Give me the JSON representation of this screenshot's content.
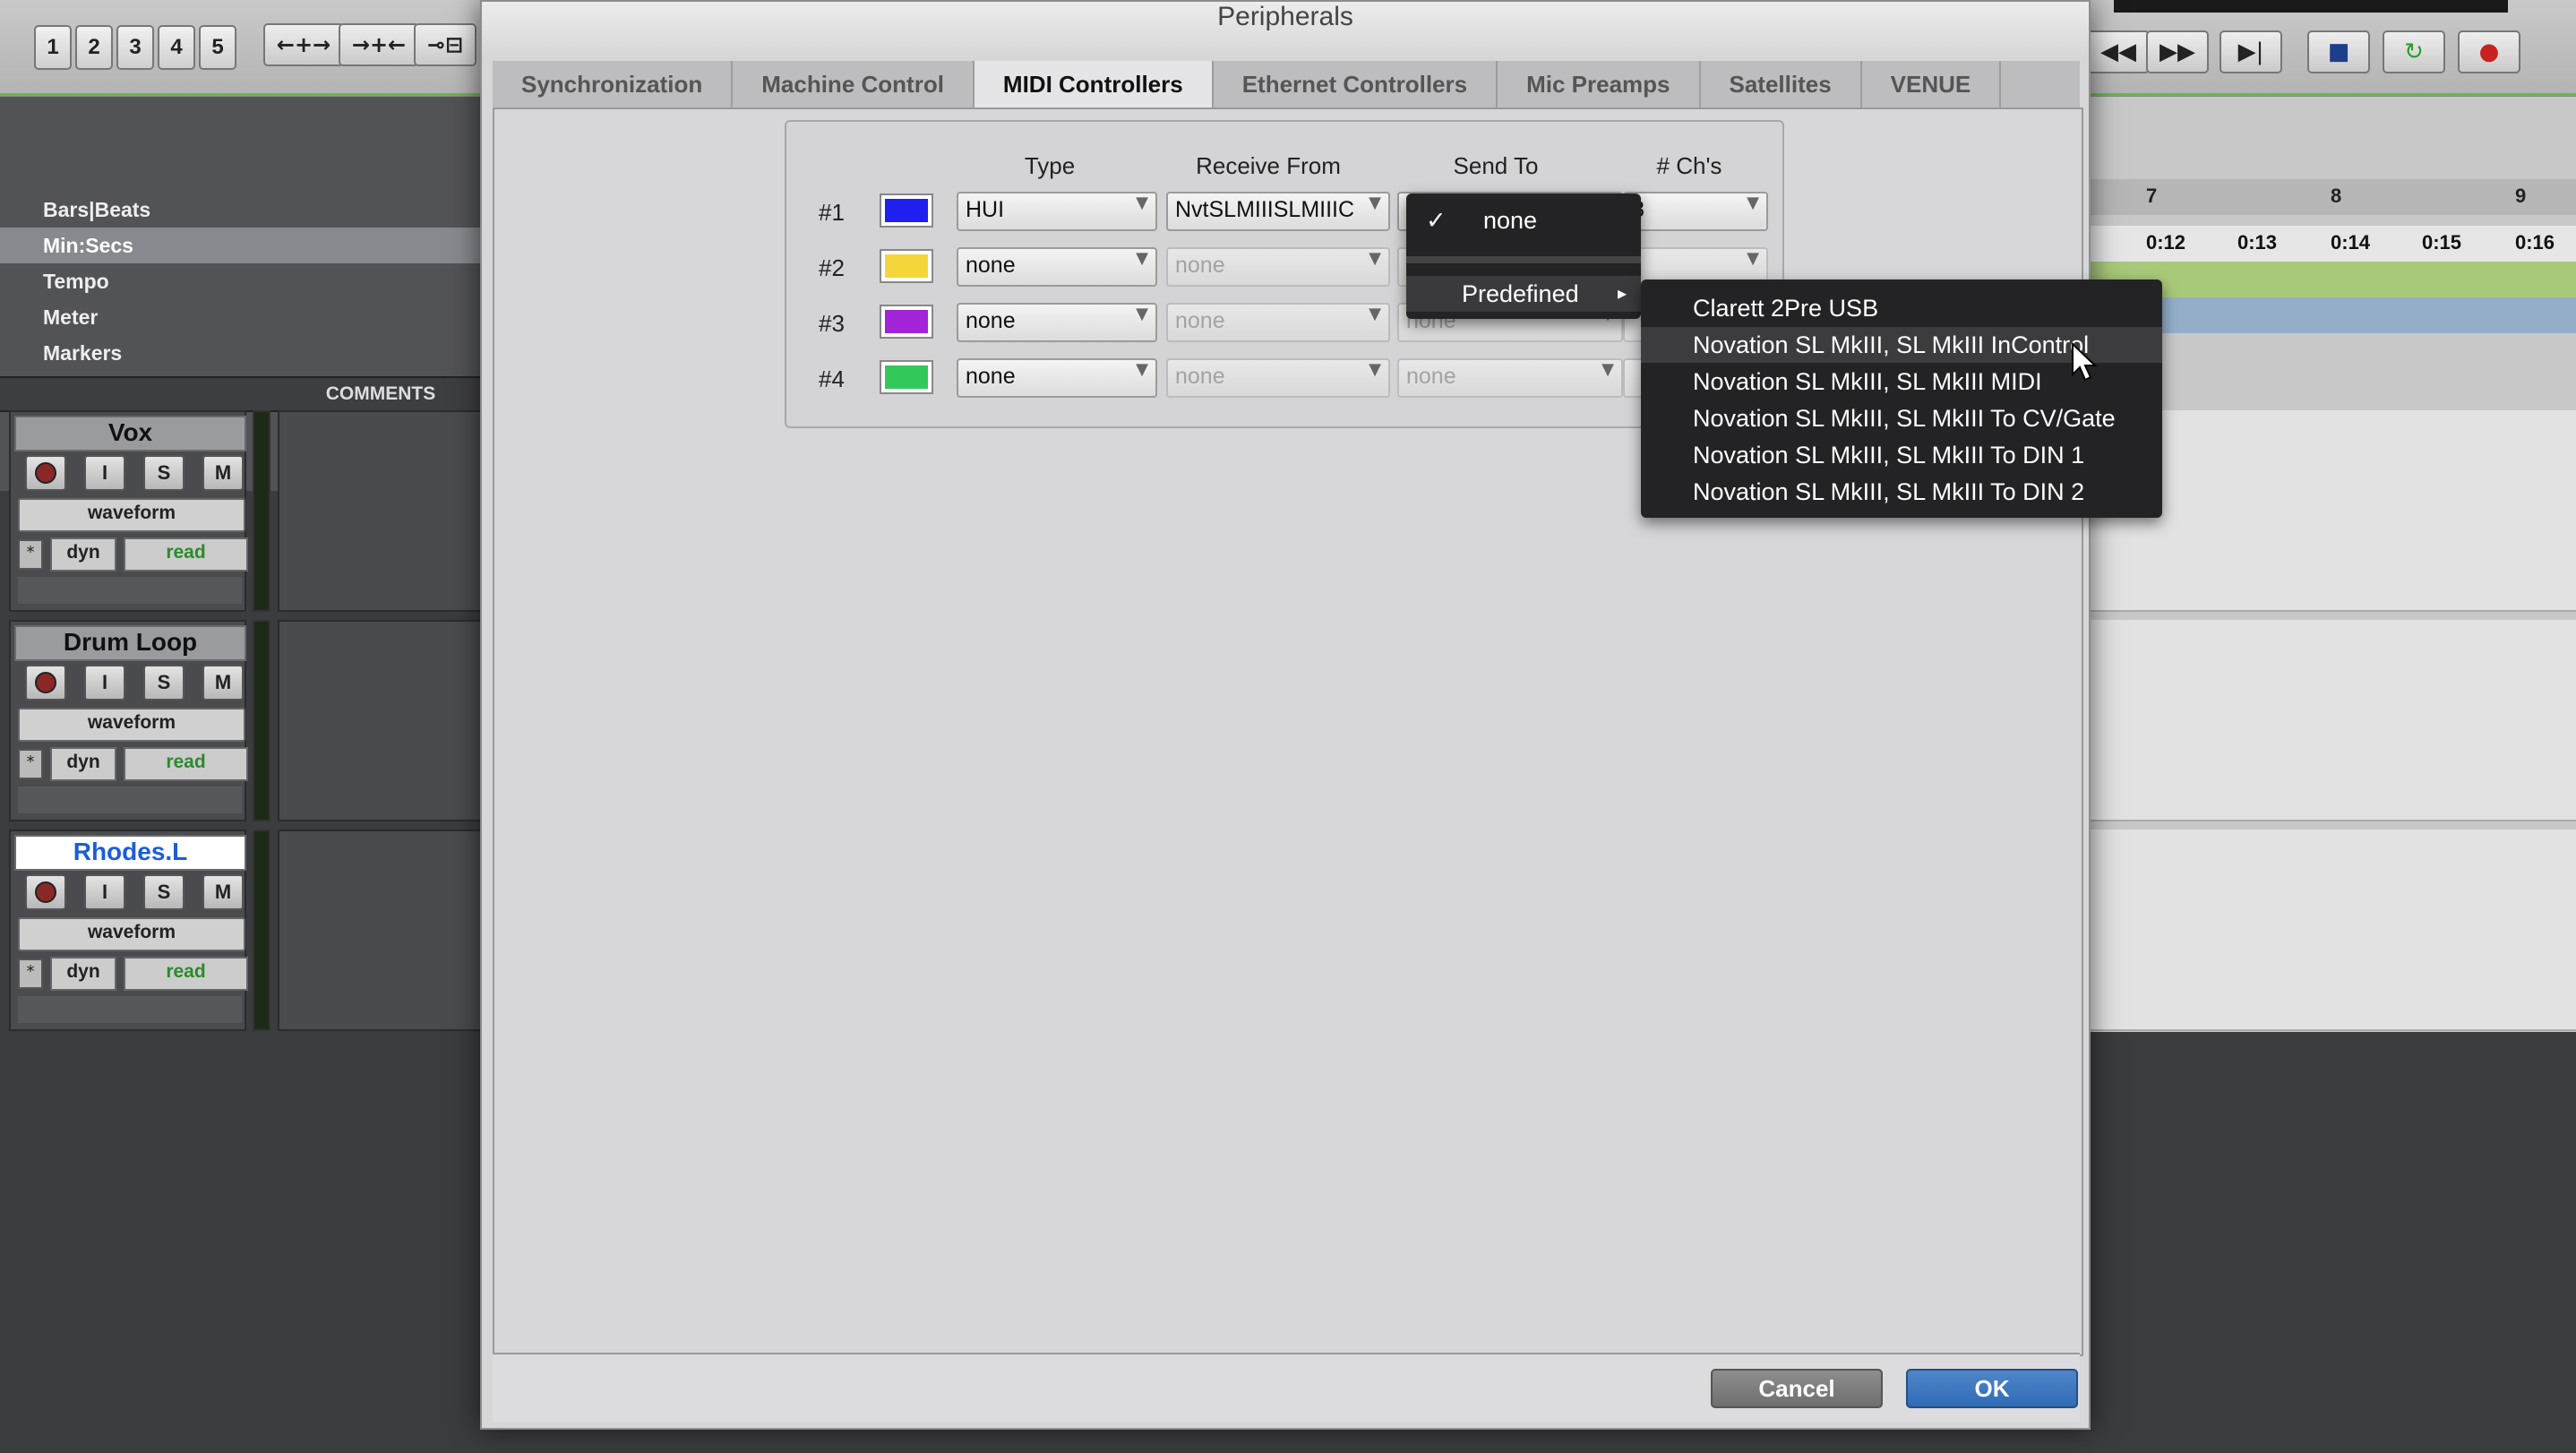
{
  "daw": {
    "toolbar": {
      "zoom_presets": [
        "1",
        "2",
        "3",
        "4",
        "5"
      ],
      "edit_tool_glyphs": [
        "←+→",
        "→+←",
        "⊸⊟"
      ],
      "transport_glyphs": [
        "◀◀",
        "▶▶",
        "▶|",
        "■",
        "↻",
        "●"
      ]
    },
    "rulers": {
      "items": [
        "Bars|Beats",
        "Min:Secs",
        "Tempo",
        "Meter",
        "Markers"
      ],
      "selected": "Min:Secs"
    },
    "comments_header": "COMMENTS",
    "tracks": [
      {
        "name": "Vox",
        "view": "waveform",
        "dyn_label": "dyn",
        "automation": "read"
      },
      {
        "name": "Drum Loop",
        "view": "waveform",
        "dyn_label": "dyn",
        "automation": "read"
      },
      {
        "name": "Rhodes.L",
        "view": "waveform",
        "dyn_label": "dyn",
        "automation": "read"
      }
    ],
    "track_button_labels": {
      "input": "I",
      "solo": "S",
      "mute": "M"
    },
    "timeline": {
      "bars": [
        "7",
        "8",
        "9"
      ],
      "secs": [
        "0:12",
        "0:13",
        "0:14",
        "0:15",
        "0:16"
      ]
    }
  },
  "dialog": {
    "title": "Peripherals",
    "tabs": [
      "Synchronization",
      "Machine Control",
      "MIDI Controllers",
      "Ethernet Controllers",
      "Mic Preamps",
      "Satellites",
      "VENUE"
    ],
    "active_tab": "MIDI Controllers",
    "columns": {
      "type": "Type",
      "receive_from": "Receive From",
      "send_to": "Send To",
      "channels": "# Ch's"
    },
    "rows": [
      {
        "label": "#1",
        "color": "#1f1ff0",
        "type": "HUI",
        "receive_from": "NvtSLMIIISLMIIIC",
        "send_to": "n",
        "channels": "8"
      },
      {
        "label": "#2",
        "color": "#f5d63a",
        "type": "none",
        "receive_from": "none",
        "send_to": "",
        "channels": ""
      },
      {
        "label": "#3",
        "color": "#a223d8",
        "type": "none",
        "receive_from": "none",
        "send_to": "none",
        "channels": ""
      },
      {
        "label": "#4",
        "color": "#32c95a",
        "type": "none",
        "receive_from": "none",
        "send_to": "none",
        "channels": ""
      }
    ],
    "send_to_menu": {
      "checked_item": "none",
      "checkmark": "✓",
      "submenu_label": "Predefined",
      "submenu_arrow": "▸"
    },
    "predefined_menu": {
      "items": [
        "Clarett 2Pre USB",
        "Novation SL MkIII, SL MkIII InControl",
        "Novation SL MkIII, SL MkIII MIDI",
        "Novation SL MkIII, SL MkIII To CV/Gate",
        "Novation SL MkIII, SL MkIII To DIN 1",
        "Novation SL MkIII, SL MkIII To DIN 2"
      ],
      "highlighted": "Novation SL MkIII, SL MkIII InControl"
    },
    "buttons": {
      "cancel": "Cancel",
      "ok": "OK"
    }
  }
}
